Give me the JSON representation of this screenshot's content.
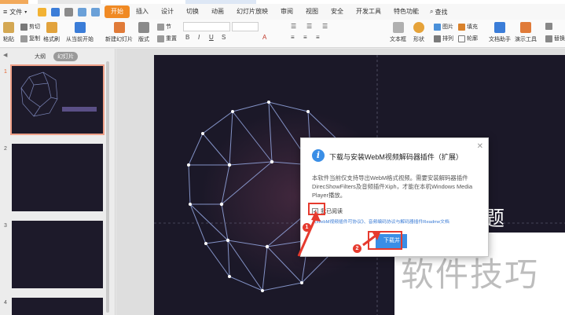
{
  "menu": {
    "file_label": "文件",
    "tabs": [
      "开始",
      "插入",
      "设计",
      "切换",
      "动画",
      "幻灯片放映",
      "审阅",
      "视图",
      "安全",
      "开发工具",
      "特色功能"
    ],
    "active_tab": "开始",
    "search_label": "查找"
  },
  "ribbon": {
    "paste": "粘贴",
    "cut": "剪切",
    "copy": "复制",
    "format_painter": "格式刷",
    "from_current": "从当前开始",
    "new_slide": "新建幻灯片",
    "layout": "版式",
    "section": "节",
    "reset": "重置",
    "textbox": "文本框",
    "shape": "形状",
    "image": "图片",
    "fill": "填充",
    "arrange": "排列",
    "outline": "轮廓",
    "doc_helper": "文档助手",
    "presentation_tools": "演示工具",
    "replace": "替换"
  },
  "leftpane": {
    "collapse": "◀",
    "tab_outline": "大纲",
    "tab_slides": "幻灯片",
    "slide_numbers": [
      "1",
      "2",
      "3",
      "4"
    ]
  },
  "slide": {
    "title_fragment": "题"
  },
  "watermark": "软件技巧",
  "dialog": {
    "title": "下载与安装WebM视频解码器插件（扩展）",
    "body": "本软件当前仅支持导出WebM格式视频。需要安装解码器插件DirecShowFilters及音频插件Xiph，才能在本机Windows Media Player播放。",
    "checkbox_label": "我已阅读",
    "checkbox_checked": true,
    "links": "《WebM视频插件可协议》、音频编码协议与解码器插件Readme文档",
    "button_label": "下载并",
    "close": "✕"
  },
  "annotations": [
    "1",
    "2"
  ],
  "colors": {
    "accent": "#f08a24",
    "annotation_red": "#e63a2e",
    "dialog_blue": "#3a8ee6",
    "slide_bg": "#1b1828"
  }
}
